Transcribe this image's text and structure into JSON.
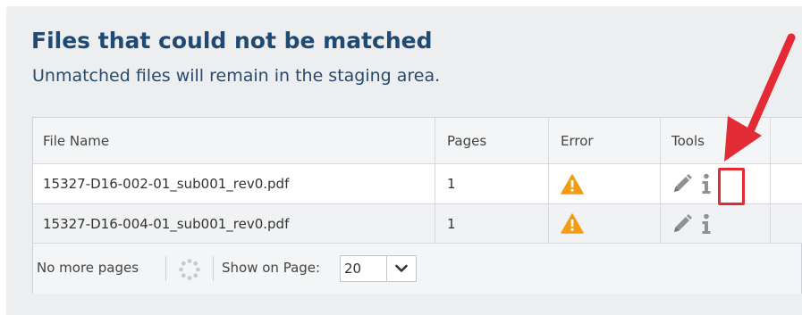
{
  "section": {
    "title": "Files that could not be matched",
    "subtitle": "Unmatched files will remain in the staging area."
  },
  "table": {
    "columns": [
      "File Name",
      "Pages",
      "Error",
      "Tools"
    ],
    "rows": [
      {
        "file_name": "15327-D16-002-01_sub001_rev0.pdf",
        "pages": "1",
        "error_icon": "warning-icon",
        "tools": [
          "pencil-icon",
          "info-icon"
        ]
      },
      {
        "file_name": "15327-D16-004-01_sub001_rev0.pdf",
        "pages": "1",
        "error_icon": "warning-icon",
        "tools": [
          "pencil-icon",
          "info-icon"
        ]
      }
    ]
  },
  "footer": {
    "status": "No more pages",
    "show_on_page_label": "Show on Page:",
    "page_size_value": "20"
  },
  "colors": {
    "title": "#1f4a73",
    "warning": "#f39c12",
    "highlight": "#e32b36"
  }
}
